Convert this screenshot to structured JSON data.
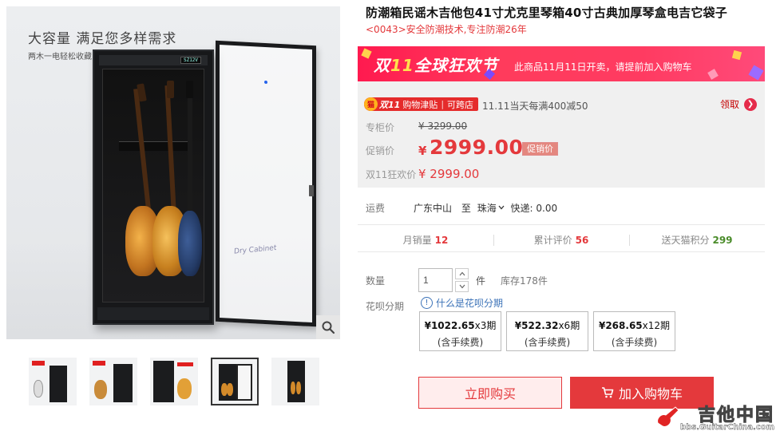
{
  "gallery": {
    "banner_title": "大容量 满足您多样需求",
    "banner_sub": "两木一电轻松收藏",
    "cabinet_display": "SZ12V",
    "door_text": "Dry Cabinet",
    "thumbs": [
      "thumb-1",
      "thumb-2",
      "thumb-3",
      "thumb-4",
      "thumb-5"
    ],
    "active_thumb": 4
  },
  "product": {
    "title": "防潮箱民谣木吉他包41寸尤克里琴箱40寸古典加厚琴盒电吉它袋子",
    "subtitle": "<0043>安全防潮技术,专注防潮26年"
  },
  "promo": {
    "logo_a": "双",
    "logo_b": "11",
    "logo_c": "全球狂欢节",
    "text": "此商品11月11日开卖，请提前加入购物车"
  },
  "price": {
    "badge_num": "双11",
    "badge_a": "购物津贴",
    "badge_b": "可跨店",
    "note": "11.11当天每满400减50",
    "claim": "领取",
    "orig_label": "专柜价",
    "orig_value": "¥ 3299.00",
    "sale_label": "促销价",
    "sale_yen": "¥",
    "sale_value": "2999.00",
    "sale_badge": "促销价",
    "d11_label": "双11狂欢价",
    "d11_value": "¥ 2999.00"
  },
  "shipping": {
    "label": "运费",
    "from": "广东中山",
    "to_word": "至",
    "to": "珠海",
    "method": "快递: 0.00"
  },
  "stats": [
    {
      "label": "月销量",
      "value": "12",
      "color": "#e4393c"
    },
    {
      "label": "累计评价",
      "value": "56",
      "color": "#e4393c"
    },
    {
      "label": "送天猫积分",
      "value": "299",
      "color": "#4a8c2a"
    }
  ],
  "quantity": {
    "label": "数量",
    "value": "1",
    "unit": "件",
    "stock": "库存178件"
  },
  "huabei": {
    "label": "花呗分期",
    "link": "什么是花呗分期",
    "plans": [
      {
        "amount": "¥1022.65",
        "periods": "x3期",
        "fee": "(含手续费)"
      },
      {
        "amount": "¥522.32",
        "periods": "x6期",
        "fee": "(含手续费)"
      },
      {
        "amount": "¥268.65",
        "periods": "x12期",
        "fee": "(含手续费)"
      }
    ]
  },
  "actions": {
    "buy_now": "立即购买",
    "add_cart": "加入购物车"
  },
  "watermark": {
    "text": "吉他中国",
    "url": "bbs.GuitarChina.com"
  },
  "colors": {
    "accent": "#e4393c",
    "promo": "#ff2a55",
    "link": "#3c73b8"
  }
}
